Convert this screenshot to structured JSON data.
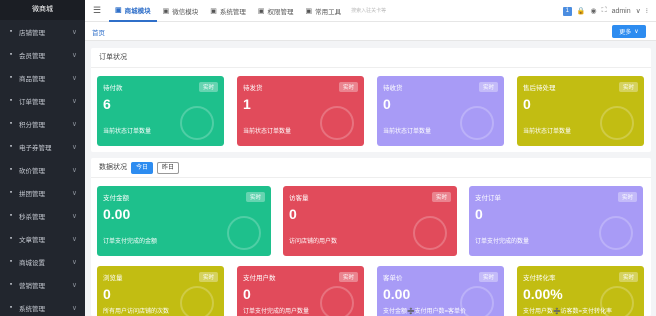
{
  "sidebar": {
    "title": "微商城",
    "items": [
      {
        "label": "店铺管理",
        "icon": "store-icon"
      },
      {
        "label": "会员管理",
        "icon": "user-icon"
      },
      {
        "label": "商品管理",
        "icon": "goods-icon"
      },
      {
        "label": "订单管理",
        "icon": "order-icon"
      },
      {
        "label": "积分管理",
        "icon": "points-icon"
      },
      {
        "label": "电子券管理",
        "icon": "coupon-icon"
      },
      {
        "label": "砍价管理",
        "icon": "bargain-icon"
      },
      {
        "label": "拼团管理",
        "icon": "group-icon"
      },
      {
        "label": "秒杀管理",
        "icon": "flash-sale-icon"
      },
      {
        "label": "文章管理",
        "icon": "article-icon"
      },
      {
        "label": "商城设置",
        "icon": "settings-icon"
      },
      {
        "label": "营销管理",
        "icon": "marketing-icon"
      },
      {
        "label": "系统管理",
        "icon": "system-icon"
      }
    ]
  },
  "topbar": {
    "nav": [
      {
        "label": "商城模块",
        "active": true
      },
      {
        "label": "微信模块",
        "active": false
      },
      {
        "label": "系统管理",
        "active": false
      },
      {
        "label": "权限管理",
        "active": false
      },
      {
        "label": "常用工具",
        "active": false
      }
    ],
    "search_placeholder": "搜索入驻关卡等",
    "user": "admin",
    "badge": "1"
  },
  "tabs": {
    "home": "首页",
    "more": "更多"
  },
  "order_status": {
    "title": "订单状况",
    "cards": [
      {
        "title": "待付款",
        "badge": "实时",
        "value": "6",
        "desc": "当前状态订单数量",
        "color": "green"
      },
      {
        "title": "待发货",
        "badge": "实时",
        "value": "1",
        "desc": "当前状态订单数量",
        "color": "red"
      },
      {
        "title": "待收货",
        "badge": "实时",
        "value": "0",
        "desc": "当前状态订单数量",
        "color": "purple"
      },
      {
        "title": "售后待处理",
        "badge": "实时",
        "value": "0",
        "desc": "当前状态订单数量",
        "color": "olive"
      }
    ]
  },
  "data_status": {
    "title": "数据状况",
    "today": "今日",
    "yesterday": "昨日",
    "row1": [
      {
        "title": "支付金额",
        "badge": "实时",
        "value": "0.00",
        "desc": "订单支付完成的金额",
        "color": "green"
      },
      {
        "title": "访客量",
        "badge": "实时",
        "value": "0",
        "desc": "访问店铺的用户数",
        "color": "red"
      },
      {
        "title": "支付订单",
        "badge": "实时",
        "value": "0",
        "desc": "订单支付完成的数量",
        "color": "purple"
      }
    ],
    "row2": [
      {
        "title": "浏览量",
        "badge": "实时",
        "value": "0",
        "desc": "所有用户访问店铺的次数",
        "color": "olive"
      },
      {
        "title": "支付用户数",
        "badge": "实时",
        "value": "0",
        "desc": "订单支付完成的用户数量",
        "color": "red"
      },
      {
        "title": "客单价",
        "badge": "实时",
        "value": "0.00",
        "desc": "支付金额➗支付用户数=客单价",
        "color": "purple"
      },
      {
        "title": "支付转化率",
        "badge": "实时",
        "value": "0.00%",
        "desc": "支付用户数➗访客数=支付转化率",
        "color": "olive"
      }
    ]
  }
}
